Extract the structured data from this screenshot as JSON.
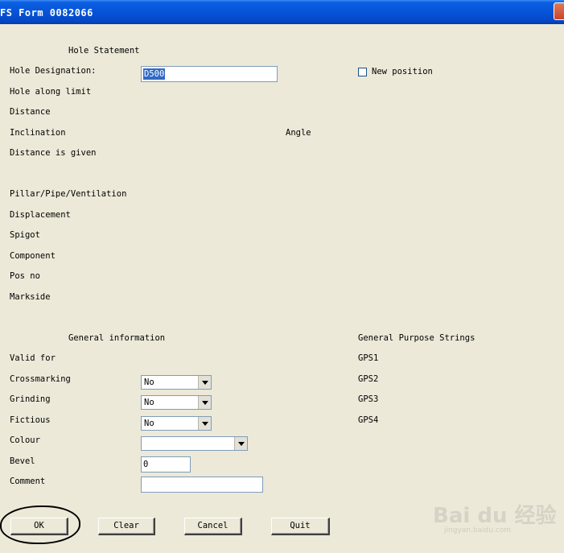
{
  "window": {
    "title": "FS Form 0082066"
  },
  "hole_statement": {
    "header": "Hole Statement",
    "designation_label": "Hole Designation:",
    "designation_value": "D500",
    "new_position_label": "New position",
    "along_limit_label": "Hole along limit",
    "distance_label": "Distance",
    "inclination_label": "Inclination",
    "angle_label": "Angle",
    "distance_given_label": "Distance is given",
    "pillar_label": "Pillar/Pipe/Ventilation",
    "displacement_label": "Displacement",
    "spigot_label": "Spigot",
    "component_label": "Component",
    "pos_no_label": "Pos no",
    "markside_label": "Markside"
  },
  "general": {
    "header": "General information",
    "valid_for_label": "Valid for",
    "crossmarking_label": "Crossmarking",
    "crossmarking_value": "No",
    "grinding_label": "Grinding",
    "grinding_value": "No",
    "fictious_label": "Fictious",
    "fictious_value": "No",
    "colour_label": "Colour",
    "colour_value": "",
    "bevel_label": "Bevel",
    "bevel_value": "0",
    "comment_label": "Comment",
    "comment_value": ""
  },
  "gps": {
    "header": "General Purpose Strings",
    "gps1": "GPS1",
    "gps2": "GPS2",
    "gps3": "GPS3",
    "gps4": "GPS4"
  },
  "buttons": {
    "ok": "OK",
    "clear": "Clear",
    "cancel": "Cancel",
    "quit": "Quit"
  },
  "watermark": {
    "main": "Bai du 经验",
    "sub": "jingyan.baidu.com"
  }
}
